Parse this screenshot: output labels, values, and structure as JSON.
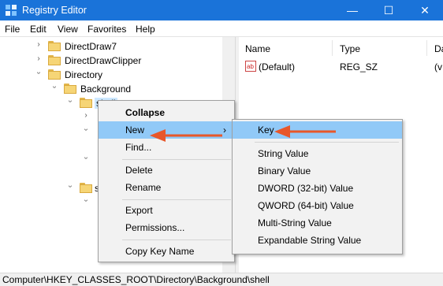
{
  "window": {
    "title": "Registry Editor",
    "minimize": "—",
    "maximize": "☐",
    "close": "✕"
  },
  "menu": [
    "File",
    "Edit",
    "View",
    "Favorites",
    "Help"
  ],
  "tree": {
    "items": [
      {
        "label": "DirectDraw7"
      },
      {
        "label": "DirectDrawClipper"
      },
      {
        "label": "Directory"
      },
      {
        "label": "Background"
      },
      {
        "label": "shell"
      },
      {
        "label": "s"
      }
    ]
  },
  "list": {
    "columns": [
      "Name",
      "Type",
      "Da"
    ],
    "rows": [
      {
        "name": "(Default)",
        "type": "REG_SZ",
        "data": "(v"
      }
    ]
  },
  "context_menu": {
    "items": [
      "Collapse",
      "New",
      "Find...",
      "Delete",
      "Rename",
      "Export",
      "Permissions...",
      "Copy Key Name"
    ],
    "highlighted": "New"
  },
  "submenu": {
    "items": [
      "Key",
      "String Value",
      "Binary Value",
      "DWORD (32-bit) Value",
      "QWORD (64-bit) Value",
      "Multi-String Value",
      "Expandable String Value"
    ],
    "highlighted": "Key"
  },
  "status": {
    "path": "Computer\\HKEY_CLASSES_ROOT\\Directory\\Background\\shell"
  },
  "colors": {
    "titlebar": "#1a73d9",
    "highlight": "#91c9f7",
    "arrow": "#e8572a"
  },
  "icons": {
    "chevron": "›",
    "submenu_arrow": "›"
  }
}
